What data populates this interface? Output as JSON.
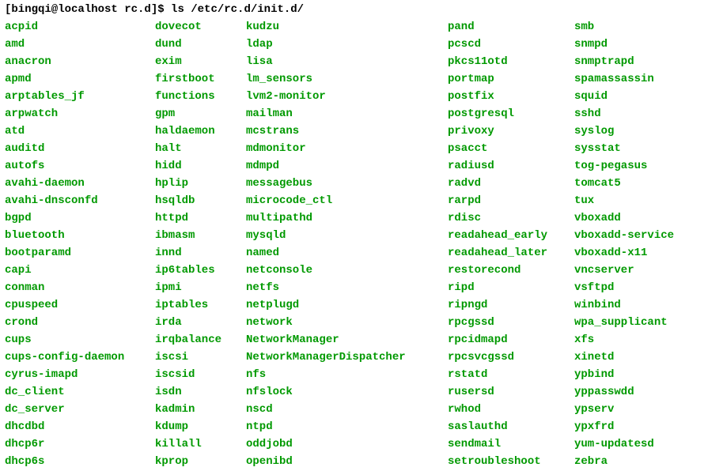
{
  "prompt": {
    "user_host": "[bingqi@localhost rc.d]$",
    "command": "ls /etc/rc.d/init.d/"
  },
  "columns": [
    [
      "acpid",
      "amd",
      "anacron",
      "apmd",
      "arptables_jf",
      "arpwatch",
      "atd",
      "auditd",
      "autofs",
      "avahi-daemon",
      "avahi-dnsconfd",
      "bgpd",
      "bluetooth",
      "bootparamd",
      "capi",
      "conman",
      "cpuspeed",
      "crond",
      "cups",
      "cups-config-daemon",
      "cyrus-imapd",
      "dc_client",
      "dc_server",
      "dhcdbd",
      "dhcp6r",
      "dhcp6s"
    ],
    [
      "dovecot",
      "dund",
      "exim",
      "firstboot",
      "functions",
      "gpm",
      "haldaemon",
      "halt",
      "hidd",
      "hplip",
      "hsqldb",
      "httpd",
      "ibmasm",
      "innd",
      "ip6tables",
      "ipmi",
      "iptables",
      "irda",
      "irqbalance",
      "iscsi",
      "iscsid",
      "isdn",
      "kadmin",
      "kdump",
      "killall",
      "kprop"
    ],
    [
      "kudzu",
      "ldap",
      "lisa",
      "lm_sensors",
      "lvm2-monitor",
      "mailman",
      "mcstrans",
      "mdmonitor",
      "mdmpd",
      "messagebus",
      "microcode_ctl",
      "multipathd",
      "mysqld",
      "named",
      "netconsole",
      "netfs",
      "netplugd",
      "network",
      "NetworkManager",
      "NetworkManagerDispatcher",
      "nfs",
      "nfslock",
      "nscd",
      "ntpd",
      "oddjobd",
      "openibd"
    ],
    [
      "pand",
      "pcscd",
      "pkcs11otd",
      "portmap",
      "postfix",
      "postgresql",
      "privoxy",
      "psacct",
      "radiusd",
      "radvd",
      "rarpd",
      "rdisc",
      "readahead_early",
      "readahead_later",
      "restorecond",
      "ripd",
      "ripngd",
      "rpcgssd",
      "rpcidmapd",
      "rpcsvcgssd",
      "rstatd",
      "rusersd",
      "rwhod",
      "saslauthd",
      "sendmail",
      "setroubleshoot"
    ],
    [
      "smb",
      "snmpd",
      "snmptrapd",
      "spamassassin",
      "squid",
      "sshd",
      "syslog",
      "sysstat",
      "tog-pegasus",
      "tomcat5",
      "tux",
      "vboxadd",
      "vboxadd-service",
      "vboxadd-x11",
      "vncserver",
      "vsftpd",
      "winbind",
      "wpa_supplicant",
      "xfs",
      "xinetd",
      "ypbind",
      "yppasswdd",
      "ypserv",
      "ypxfrd",
      "yum-updatesd",
      "zebra"
    ]
  ]
}
